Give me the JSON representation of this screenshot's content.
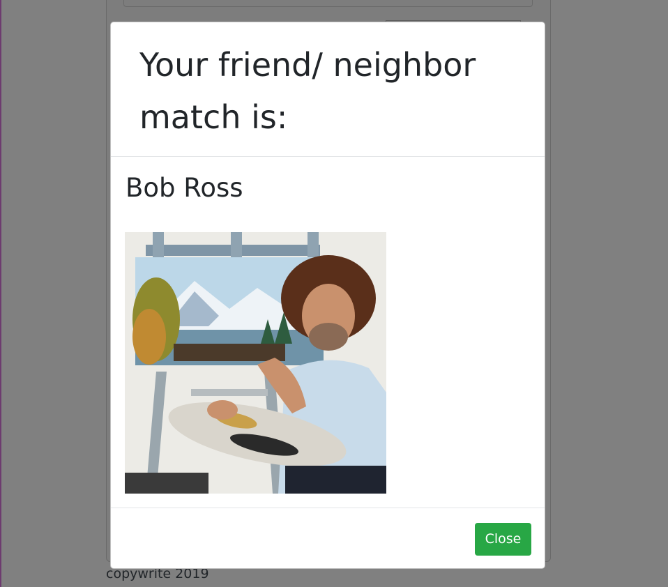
{
  "modal": {
    "title": "Your friend/ neighbor match is:",
    "match_name": "Bob Ross",
    "photo_icon": "bob-ross-portrait",
    "close_label": "Close"
  },
  "footer": {
    "text": "copywrite 2019"
  },
  "colors": {
    "overlay": "#808080",
    "close_button": "#28a745",
    "text": "#212529"
  }
}
